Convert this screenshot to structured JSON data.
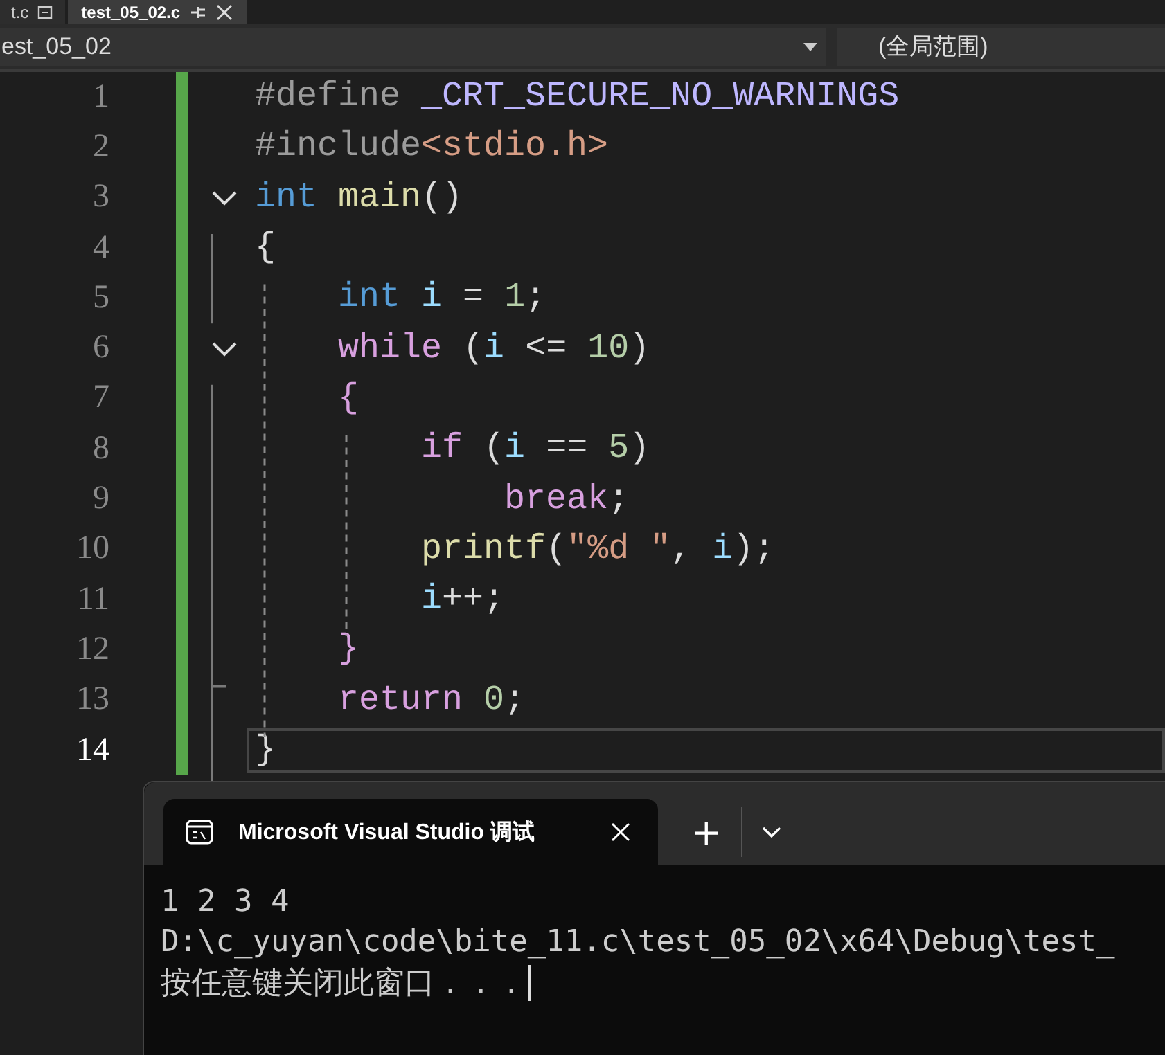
{
  "file_tabs": [
    {
      "label": "t.c",
      "selected": false,
      "pinned": true
    },
    {
      "label": "test_05_02.c",
      "selected": true,
      "pinned": false
    }
  ],
  "nav_bar": {
    "project": "est_05_02",
    "scope": "(全局范围)"
  },
  "editor": {
    "lines": [
      {
        "number": "1",
        "foldable": false,
        "current": false,
        "tokens": [
          {
            "kind": "pre",
            "text": "#define "
          },
          {
            "kind": "macro",
            "text": "_CRT_SECURE_NO_WARNINGS"
          }
        ]
      },
      {
        "number": "2",
        "foldable": false,
        "current": false,
        "tokens": [
          {
            "kind": "pre",
            "text": "#include"
          },
          {
            "kind": "string",
            "text": "<stdio.h>"
          }
        ]
      },
      {
        "number": "3",
        "foldable": true,
        "current": false,
        "tokens": [
          {
            "kind": "type",
            "text": "int"
          },
          {
            "kind": "func",
            "text": " main"
          },
          {
            "kind": "plain",
            "text": "()"
          }
        ]
      },
      {
        "number": "4",
        "foldable": false,
        "current": false,
        "tokens": [
          {
            "kind": "plain",
            "text": "{"
          }
        ]
      },
      {
        "number": "5",
        "foldable": false,
        "current": false,
        "tokens": [
          {
            "kind": "type",
            "text": "    int"
          },
          {
            "kind": "var",
            "text": " i"
          },
          {
            "kind": "plain",
            "text": " = "
          },
          {
            "kind": "num",
            "text": "1"
          },
          {
            "kind": "plain",
            "text": ";"
          }
        ]
      },
      {
        "number": "6",
        "foldable": true,
        "current": false,
        "tokens": [
          {
            "kind": "keyword",
            "text": "    while"
          },
          {
            "kind": "plain",
            "text": " ("
          },
          {
            "kind": "var",
            "text": "i"
          },
          {
            "kind": "plain",
            "text": " <= "
          },
          {
            "kind": "num",
            "text": "10"
          },
          {
            "kind": "plain",
            "text": ")"
          }
        ]
      },
      {
        "number": "7",
        "foldable": false,
        "current": false,
        "tokens": [
          {
            "kind": "keyword",
            "text": "    {"
          }
        ]
      },
      {
        "number": "8",
        "foldable": false,
        "current": false,
        "tokens": [
          {
            "kind": "keyword",
            "text": "        if"
          },
          {
            "kind": "plain",
            "text": " ("
          },
          {
            "kind": "var",
            "text": "i"
          },
          {
            "kind": "plain",
            "text": " == "
          },
          {
            "kind": "num",
            "text": "5"
          },
          {
            "kind": "plain",
            "text": ")"
          }
        ]
      },
      {
        "number": "9",
        "foldable": false,
        "current": false,
        "tokens": [
          {
            "kind": "keyword",
            "text": "            break"
          },
          {
            "kind": "plain",
            "text": ";"
          }
        ]
      },
      {
        "number": "10",
        "foldable": false,
        "current": false,
        "tokens": [
          {
            "kind": "func",
            "text": "        printf"
          },
          {
            "kind": "plain",
            "text": "("
          },
          {
            "kind": "string",
            "text": "\"%d \""
          },
          {
            "kind": "plain",
            "text": ", "
          },
          {
            "kind": "var",
            "text": "i"
          },
          {
            "kind": "plain",
            "text": ");"
          }
        ]
      },
      {
        "number": "11",
        "foldable": false,
        "current": false,
        "tokens": [
          {
            "kind": "var",
            "text": "        i"
          },
          {
            "kind": "plain",
            "text": "++;"
          }
        ]
      },
      {
        "number": "12",
        "foldable": false,
        "current": false,
        "tokens": [
          {
            "kind": "keyword",
            "text": "    }"
          }
        ]
      },
      {
        "number": "13",
        "foldable": false,
        "current": false,
        "tokens": [
          {
            "kind": "keyword",
            "text": "    return"
          },
          {
            "kind": "num",
            "text": " 0"
          },
          {
            "kind": "plain",
            "text": ";"
          }
        ]
      },
      {
        "number": "14",
        "foldable": false,
        "current": true,
        "tokens": [
          {
            "kind": "plain",
            "text": "}"
          }
        ]
      }
    ]
  },
  "terminal": {
    "tab_title": "Microsoft Visual Studio 调试",
    "add_tab": "+",
    "lines": [
      "1 2 3 4",
      "D:\\c_yuyan\\code\\bite_11.c\\test_05_02\\x64\\Debug\\test_",
      "按任意键关闭此窗口．．．"
    ]
  }
}
